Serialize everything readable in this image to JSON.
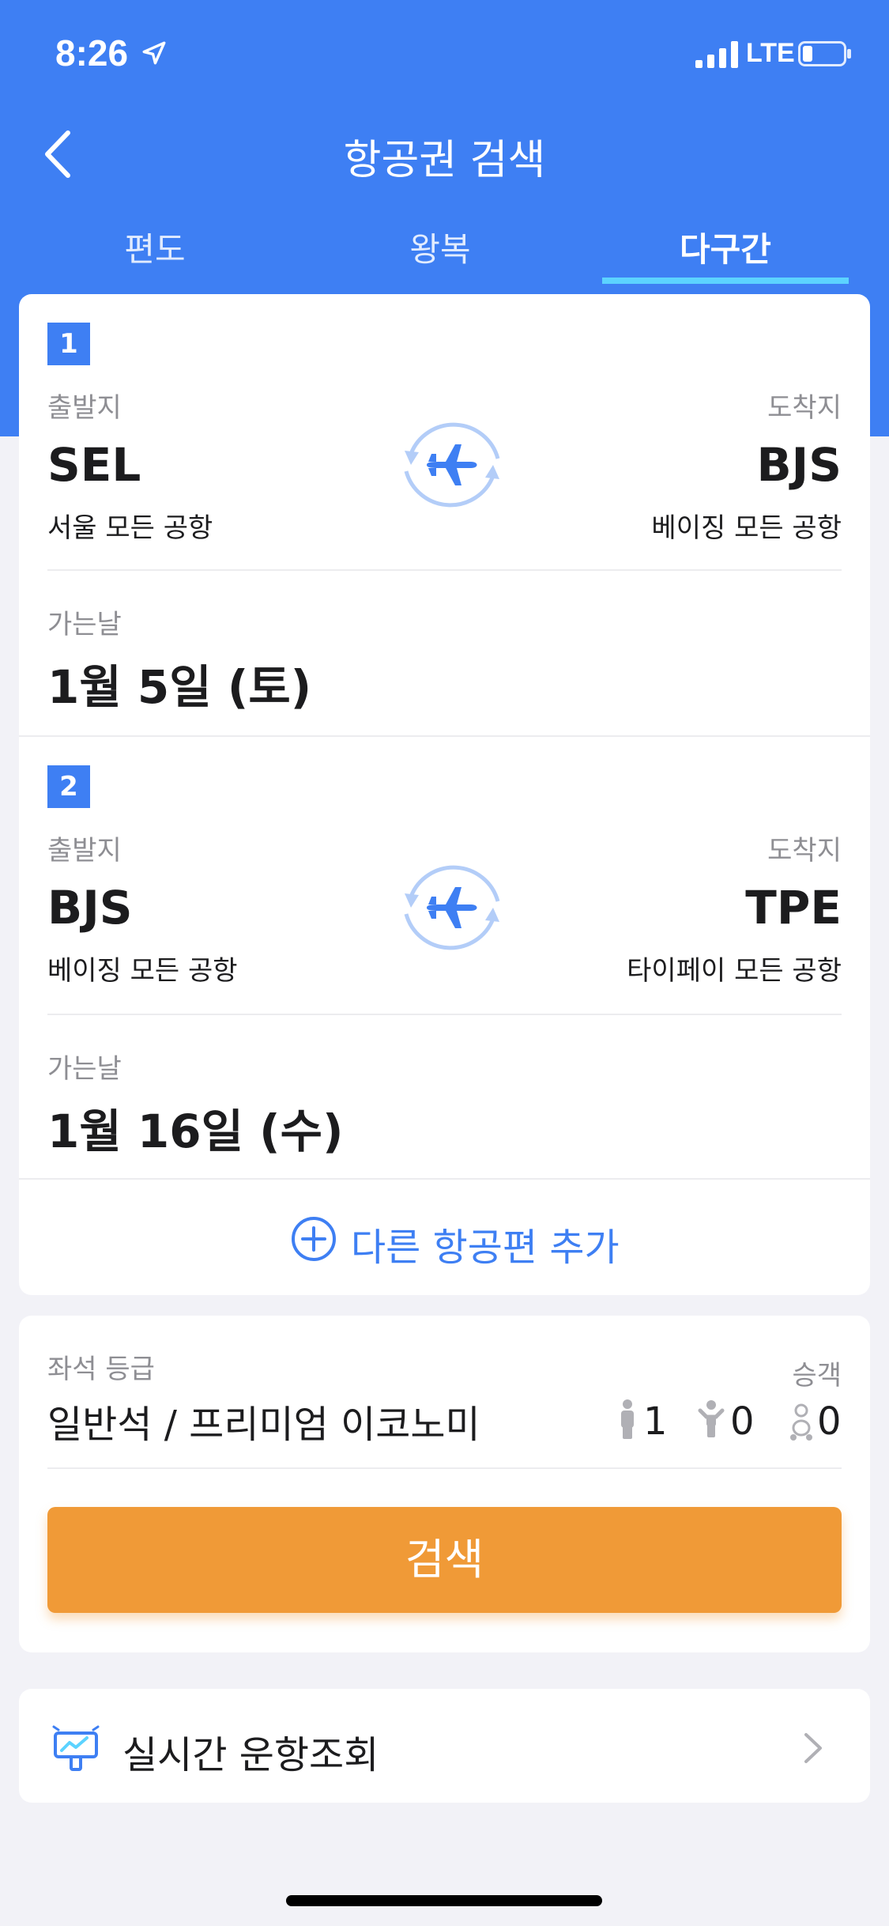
{
  "status_bar": {
    "time": "8:26",
    "network": "LTE"
  },
  "header": {
    "title": "항공권 검색",
    "tabs": [
      {
        "label": "편도",
        "active": false
      },
      {
        "label": "왕복",
        "active": false
      },
      {
        "label": "다구간",
        "active": true
      }
    ]
  },
  "segments": [
    {
      "number": "1",
      "origin_label": "출발지",
      "origin_code": "SEL",
      "origin_name": "서울 모든 공항",
      "dest_label": "도착지",
      "dest_code": "BJS",
      "dest_name": "베이징 모든 공항",
      "date_label": "가는날",
      "date": "1월 5일 (토)"
    },
    {
      "number": "2",
      "origin_label": "출발지",
      "origin_code": "BJS",
      "origin_name": "베이징 모든 공항",
      "dest_label": "도착지",
      "dest_code": "TPE",
      "dest_name": "타이페이 모든 공항",
      "date_label": "가는날",
      "date": "1월 16일 (수)"
    }
  ],
  "add_flight_label": "다른 항공편 추가",
  "options": {
    "seat_label": "좌석 등급",
    "seat_value": "일반석 / 프리미엄 이코노미",
    "passenger_label": "승객",
    "adults": "1",
    "children": "0",
    "infants": "0"
  },
  "search_button": "검색",
  "live_flight_label": "실시간 운항조회",
  "colors": {
    "primary": "#3e7ff3",
    "search": "#f09a37",
    "tab_underline": "#5cd3ff"
  }
}
